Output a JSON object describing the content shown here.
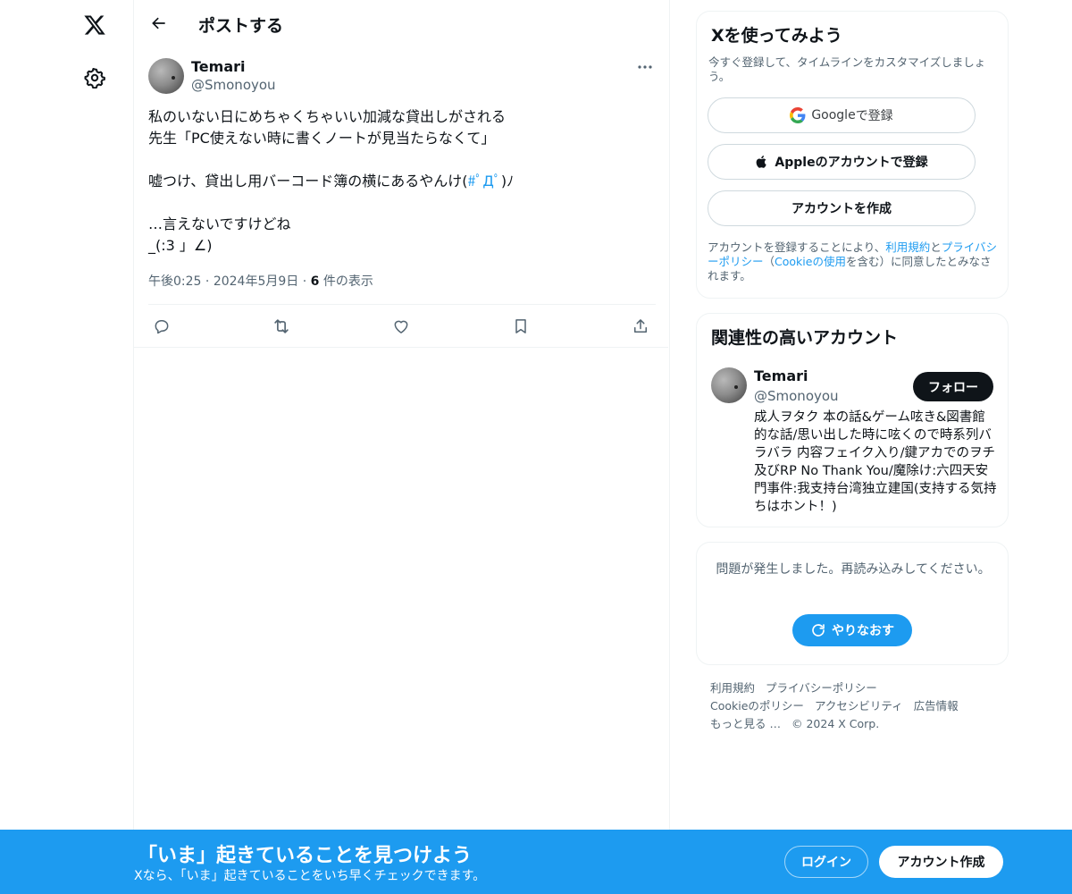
{
  "nav": {
    "logo_icon": "x-logo-icon",
    "settings_icon": "gear-icon"
  },
  "header": {
    "title": "ポストする",
    "back_icon": "arrow-left-icon"
  },
  "post": {
    "author_name": "Temari",
    "author_handle": "@Smonoyou",
    "lines": [
      "私のいない日にめちゃくちゃいい加減な貸出しがされる",
      "先生「PC使えない時に書くノートが見当たらなくて」",
      "",
      "嘘つけ、貸出し用バーコード簿の横にあるやんけ(",
      "",
      "…言えないですけどね",
      "_(:3 」∠)"
    ],
    "hashtag": "#ﾟДﾟ",
    "hashtag_tail": ")ﾉ",
    "time": "午後0:25",
    "date": "2024年5月9日",
    "views_count": "6",
    "views_label": "件の表示",
    "dot": "·"
  },
  "actions": [
    "reply-icon",
    "retweet-icon",
    "like-icon",
    "bookmark-icon",
    "share-icon"
  ],
  "signup_card": {
    "title": "Xを使ってみよう",
    "subtitle": "今すぐ登録して、タイムラインをカスタマイズしましょう。",
    "google_brand": "Google",
    "google_suffix": " で登録",
    "apple_label": "Appleのアカウントで登録",
    "create_label": "アカウントを作成",
    "terms_pre": "アカウントを登録することにより、",
    "terms_link1": "利用規約",
    "terms_mid": "と",
    "terms_link2": "プライバシーポリシー",
    "terms_mid2": "（",
    "terms_link3": "Cookieの使用",
    "terms_post": "を含む）に同意したとみなされます。"
  },
  "relevant": {
    "title": "関連性の高いアカウント",
    "name": "Temari",
    "handle": "@Smonoyou",
    "follow_label": "フォロー",
    "bio": "成人ヲタク 本の話&ゲーム呟き&図書館的な話/思い出した時に呟くので時系列バラバラ 内容フェイク入り/鍵アカでのヲチ及びRP No Thank You/魔除け:六四天安門事件:我支持台湾独立建国(支持する気持ちはホント！)"
  },
  "error_card": {
    "message": "問題が発生しました。再読み込みしてください。",
    "retry_label": "やりなおす"
  },
  "footer": {
    "links": [
      "利用規約",
      "プライバシーポリシー",
      "Cookieのポリシー",
      "アクセシビリティ",
      "広告情報",
      "もっと見る …"
    ],
    "copyright": "© 2024 X Corp."
  },
  "banner": {
    "title": "「いま」起きていることを見つけよう",
    "subtitle": "Xなら、「いま」起きていることをいち早くチェックできます。",
    "login_label": "ログイン",
    "signup_label": "アカウント作成"
  },
  "colors": {
    "accent": "#1d9bf0",
    "text": "#0f1419",
    "muted": "#536471",
    "border": "#eff3f4"
  }
}
